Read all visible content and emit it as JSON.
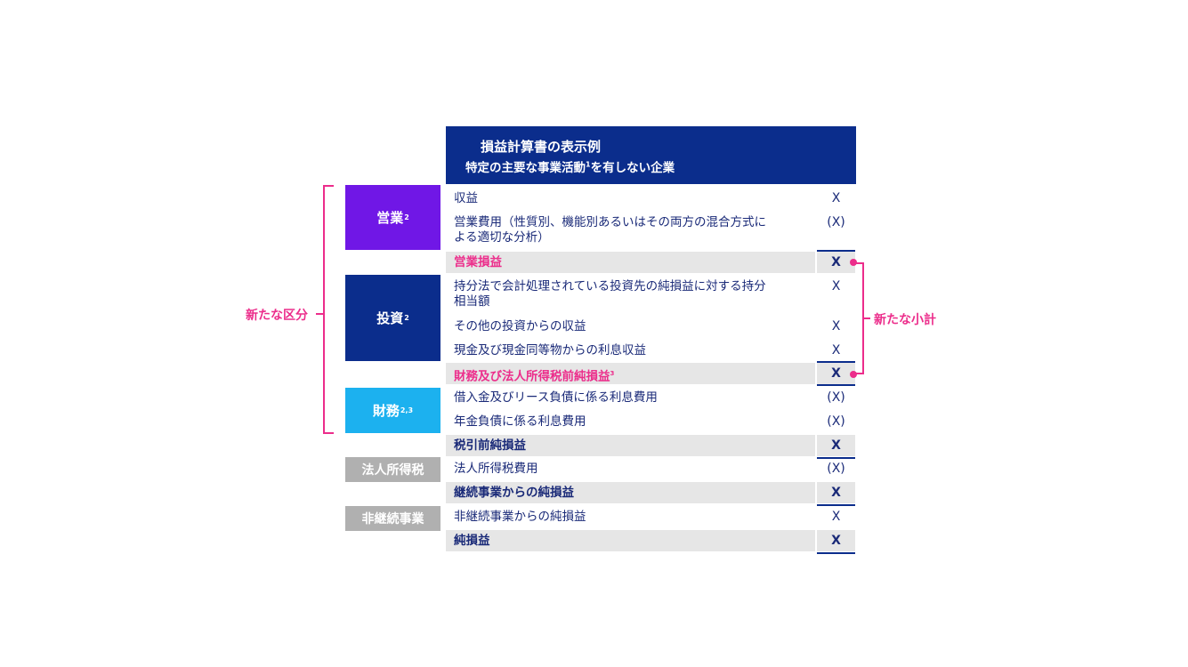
{
  "header": {
    "title": "損益計算書の表示例",
    "subtitle_pre": "特定の主要な事業活動",
    "subtitle_sup": "1",
    "subtitle_post": "を有しない企業"
  },
  "categories": {
    "operating": {
      "label": "営業",
      "sup": "2",
      "color": "#7017e6"
    },
    "investing": {
      "label": "投資",
      "sup": "2",
      "color": "#0b2d8c"
    },
    "financing": {
      "label": "財務",
      "sup": "2,3",
      "color": "#1cb1ef"
    },
    "income_tax": {
      "label": "法人所得税",
      "color": "#b0b0b0"
    },
    "discontinued": {
      "label": "非継続事業",
      "color": "#b0b0b0"
    }
  },
  "rows": [
    {
      "label": "収益",
      "value": "X"
    },
    {
      "label_line1": "営業費用（性質別、機能別あるいはその両方の混合方式に",
      "label_line2": "よる適切な分析）",
      "value": "(X)"
    },
    {
      "label": "営業損益",
      "value": "X"
    },
    {
      "label_line1": "持分法で会計処理されている投資先の純損益に対する持分",
      "label_line2": "相当額",
      "value": "X"
    },
    {
      "label": "その他の投資からの収益",
      "value": "X"
    },
    {
      "label": "現金及び現金同等物からの利息収益",
      "value": "X"
    },
    {
      "label": "財務及び法人所得税前純損益",
      "sup": "3",
      "value": "X"
    },
    {
      "label": "借入金及びリース負債に係る利息費用",
      "value": "(X)"
    },
    {
      "label": "年金負債に係る利息費用",
      "value": "(X)"
    },
    {
      "label": "税引前純損益",
      "value": "X"
    },
    {
      "label": "法人所得税費用",
      "value": "(X)"
    },
    {
      "label": "継続事業からの純損益",
      "value": "X"
    },
    {
      "label": "非継続事業からの純損益",
      "value": "X"
    },
    {
      "label": "純損益",
      "value": "X"
    }
  ],
  "annotations": {
    "new_categories": "新たな区分",
    "new_subtotals": "新たな小計",
    "accent_color": "#ec2d8b"
  }
}
